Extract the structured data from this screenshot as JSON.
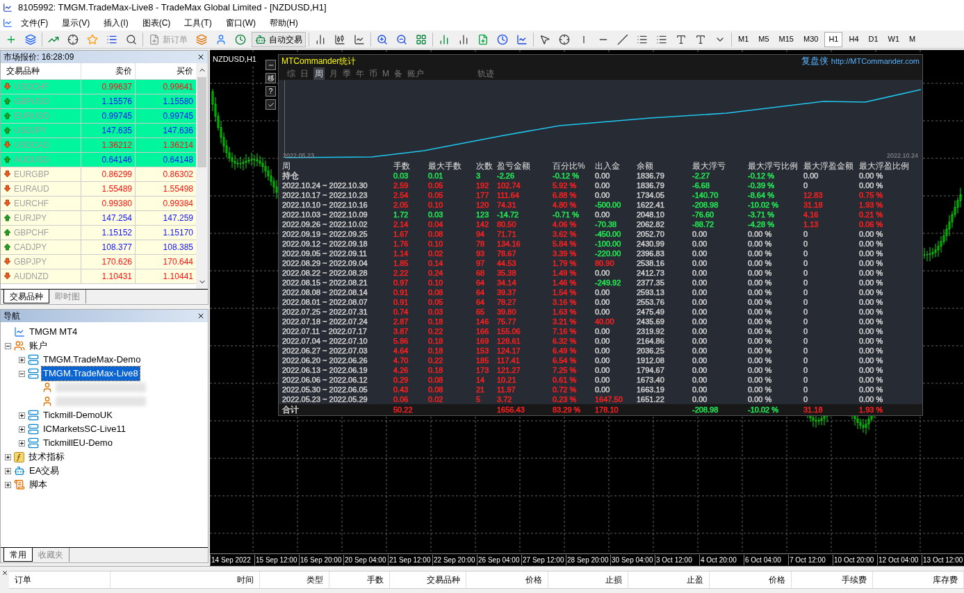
{
  "window": {
    "title": "8105992: TMGM.TradeMax-Live8 - TradeMax Global Limited - [NZDUSD,H1]"
  },
  "menu": [
    "文件(F)",
    "显示(V)",
    "插入(I)",
    "图表(C)",
    "工具(T)",
    "窗口(W)",
    "帮助(H)"
  ],
  "toolbar": {
    "new_order": {
      "label": "新订单",
      "disabled": true
    },
    "auto_trading": {
      "label": "自动交易"
    },
    "timeframes": [
      {
        "label": "M1",
        "selected": false
      },
      {
        "label": "M5",
        "selected": false
      },
      {
        "label": "M15",
        "selected": false
      },
      {
        "label": "M30",
        "selected": false
      },
      {
        "label": "H1",
        "selected": true
      },
      {
        "label": "H4",
        "selected": false
      },
      {
        "label": "D1",
        "selected": false
      },
      {
        "label": "W1",
        "selected": false
      },
      {
        "label": "M",
        "selected": false
      }
    ]
  },
  "market_watch": {
    "title": "市场报价: 16:28:09",
    "columns": [
      "交易品种",
      "卖价",
      "买价"
    ],
    "rows": [
      {
        "symbol": "USDCHF",
        "bid": "0.99637",
        "ask": "0.99641",
        "kind": "down",
        "highlighted": true
      },
      {
        "symbol": "GBPUSD",
        "bid": "1.15576",
        "ask": "1.15580",
        "kind": "up",
        "highlighted": true
      },
      {
        "symbol": "EURUSD",
        "bid": "0.99745",
        "ask": "0.99745",
        "kind": "up",
        "highlighted": true
      },
      {
        "symbol": "USDJPY",
        "bid": "147.635",
        "ask": "147.636",
        "kind": "up",
        "highlighted": true
      },
      {
        "symbol": "USDCAD",
        "bid": "1.36212",
        "ask": "1.36214",
        "kind": "down",
        "highlighted": true
      },
      {
        "symbol": "AUDUSD",
        "bid": "0.64146",
        "ask": "0.64148",
        "kind": "up",
        "highlighted": true
      },
      {
        "symbol": "EURGBP",
        "bid": "0.86299",
        "ask": "0.86302",
        "kind": "down",
        "highlighted": false
      },
      {
        "symbol": "EURAUD",
        "bid": "1.55489",
        "ask": "1.55498",
        "kind": "down",
        "highlighted": false
      },
      {
        "symbol": "EURCHF",
        "bid": "0.99380",
        "ask": "0.99384",
        "kind": "down",
        "highlighted": false
      },
      {
        "symbol": "EURJPY",
        "bid": "147.254",
        "ask": "147.259",
        "kind": "up",
        "highlighted": false
      },
      {
        "symbol": "GBPCHF",
        "bid": "1.15152",
        "ask": "1.15170",
        "kind": "up",
        "highlighted": false
      },
      {
        "symbol": "CADJPY",
        "bid": "108.377",
        "ask": "108.385",
        "kind": "up",
        "highlighted": false
      },
      {
        "symbol": "GBPJPY",
        "bid": "170.626",
        "ask": "170.644",
        "kind": "down",
        "highlighted": false
      },
      {
        "symbol": "AUDNZD",
        "bid": "1.10431",
        "ask": "1.10441",
        "kind": "down",
        "highlighted": false
      }
    ],
    "tabs": [
      {
        "label": "交易品种",
        "selected": true
      },
      {
        "label": "即时图",
        "selected": false
      }
    ]
  },
  "navigator": {
    "title": "导航",
    "tree": [
      {
        "label": "TMGM MT4",
        "kind": "terminal",
        "selected": false
      },
      {
        "label": "账户",
        "kind": "accounts",
        "expanded": true,
        "selected": false,
        "children": [
          {
            "label": "TMGM.TradeMax-Demo",
            "kind": "server",
            "expanded": false,
            "selected": false
          },
          {
            "label": "TMGM.TradeMax-Live8",
            "kind": "server",
            "expanded": true,
            "selected": true,
            "children": [
              {
                "kind": "user"
              },
              {
                "kind": "user"
              }
            ]
          },
          {
            "label": "Tickmill-DemoUK",
            "kind": "server",
            "expanded": false,
            "selected": false
          },
          {
            "label": "ICMarketsSC-Live11",
            "kind": "server",
            "expanded": false,
            "selected": false
          },
          {
            "label": "TickmillEU-Demo",
            "kind": "server",
            "expanded": false,
            "selected": false
          }
        ]
      },
      {
        "label": "技术指标",
        "kind": "indicators",
        "expanded": false,
        "selected": false
      },
      {
        "label": "EA交易",
        "kind": "experts",
        "expanded": false,
        "selected": false
      },
      {
        "label": "脚本",
        "kind": "scripts",
        "expanded": false,
        "selected": false
      }
    ],
    "tabs": [
      {
        "label": "常用",
        "selected": true
      },
      {
        "label": "收藏夹",
        "selected": false
      }
    ]
  },
  "chart": {
    "title": "NZDUSD,H1",
    "side_buttons": [
      "移",
      "?"
    ],
    "time_axis": [
      "14 Sep 2022",
      "15 Sep 12:00",
      "16 Sep 20:00",
      "20 Sep 04:00",
      "21 Sep 12:00",
      "22 Sep 20:00",
      "26 Sep 04:00",
      "27 Sep 12:00",
      "28 Sep 20:00",
      "30 Sep 04:00",
      "3 Oct 12:00",
      "4 Oct 20:00",
      "6 Oct 04:00",
      "7 Oct 12:00",
      "10 Oct 20:00",
      "12 Oct 04:00",
      "13 Oct 12:00"
    ]
  },
  "stats": {
    "title": "MTCommander统计",
    "link_label": "复盘侠",
    "link_url": "http://MTCommander.com",
    "tabs": [
      {
        "label": "综",
        "selected": false
      },
      {
        "label": "日",
        "selected": false
      },
      {
        "label": "周",
        "selected": true
      },
      {
        "label": "月",
        "selected": false
      },
      {
        "label": "季",
        "selected": false
      },
      {
        "label": "年",
        "selected": false
      },
      {
        "label": "币",
        "selected": false
      },
      {
        "label": "M",
        "selected": false
      },
      {
        "label": "备",
        "selected": false
      },
      {
        "label": "账户",
        "selected": false
      },
      {
        "label": "轨迹",
        "selected": false
      }
    ],
    "curve": {
      "start_label": "2022.05.23",
      "end_label": "2022.10.24"
    },
    "columns": [
      "周",
      "手数",
      "最大手数",
      "次数",
      "盈亏金额",
      "百分比%",
      "出入金",
      "余额",
      "最大浮亏",
      "最大浮亏比例",
      "最大浮盈金额",
      "最大浮盈比例"
    ],
    "rows": [
      {
        "cells": [
          {
            "text": "持仓"
          },
          {
            "text": "0.03",
            "color": "#22ee55"
          },
          {
            "text": "0.01",
            "color": "#22ee55"
          },
          {
            "text": "3",
            "color": "#22ee55"
          },
          {
            "text": "-2.26",
            "color": "#22ee55"
          },
          {
            "text": "-0.12 %",
            "color": "#22ee55"
          },
          {
            "text": "0.00"
          },
          {
            "text": "1836.79"
          },
          {
            "text": "-2.27",
            "color": "#22ee55"
          },
          {
            "text": "-0.12 %",
            "color": "#22ee55"
          },
          {
            "text": "0.00"
          },
          {
            "text": "0.00 %"
          }
        ]
      },
      {
        "cells": [
          {
            "text": "2022.10.24 ~ 2022.10.30"
          },
          {
            "text": "2.59",
            "color": "#ff2020"
          },
          {
            "text": "0.05",
            "color": "#ff2020"
          },
          {
            "text": "192",
            "color": "#ff2020"
          },
          {
            "text": "102.74",
            "color": "#ff2020"
          },
          {
            "text": "5.92 %",
            "color": "#ff2020"
          },
          {
            "text": "0.00"
          },
          {
            "text": "1836.79"
          },
          {
            "text": "-6.68",
            "color": "#22ee55"
          },
          {
            "text": "-0.39 %",
            "color": "#22ee55"
          },
          {
            "text": "0"
          },
          {
            "text": "0.00 %"
          }
        ]
      },
      {
        "cells": [
          {
            "text": "2022.10.17 ~ 2022.10.23"
          },
          {
            "text": "2.54",
            "color": "#ff2020"
          },
          {
            "text": "0.05",
            "color": "#ff2020"
          },
          {
            "text": "177",
            "color": "#ff2020"
          },
          {
            "text": "111.64",
            "color": "#ff2020"
          },
          {
            "text": "6.88 %",
            "color": "#ff2020"
          },
          {
            "text": "0.00"
          },
          {
            "text": "1734.05"
          },
          {
            "text": "-140.70",
            "color": "#22ee55"
          },
          {
            "text": "-8.64 %",
            "color": "#22ee55"
          },
          {
            "text": "12.83",
            "color": "#ff2020"
          },
          {
            "text": "0.75 %",
            "color": "#ff2020"
          }
        ]
      },
      {
        "cells": [
          {
            "text": "2022.10.10 ~ 2022.10.16"
          },
          {
            "text": "2.05",
            "color": "#ff2020"
          },
          {
            "text": "0.10",
            "color": "#ff2020"
          },
          {
            "text": "120",
            "color": "#ff2020"
          },
          {
            "text": "74.31",
            "color": "#ff2020"
          },
          {
            "text": "4.80 %",
            "color": "#ff2020"
          },
          {
            "text": "-500.00",
            "color": "#22ee55"
          },
          {
            "text": "1622.41"
          },
          {
            "text": "-208.98",
            "color": "#22ee55"
          },
          {
            "text": "-10.02 %",
            "color": "#22ee55"
          },
          {
            "text": "31.18",
            "color": "#ff2020"
          },
          {
            "text": "1.93 %",
            "color": "#ff2020"
          }
        ]
      },
      {
        "cells": [
          {
            "text": "2022.10.03 ~ 2022.10.09"
          },
          {
            "text": "1.72",
            "color": "#22ee55"
          },
          {
            "text": "0.03",
            "color": "#22ee55"
          },
          {
            "text": "123",
            "color": "#22ee55"
          },
          {
            "text": "-14.72",
            "color": "#22ee55"
          },
          {
            "text": "-0.71 %",
            "color": "#22ee55"
          },
          {
            "text": "0.00"
          },
          {
            "text": "2048.10"
          },
          {
            "text": "-76.60",
            "color": "#22ee55"
          },
          {
            "text": "-3.71 %",
            "color": "#22ee55"
          },
          {
            "text": "4.16",
            "color": "#ff2020"
          },
          {
            "text": "0.21 %",
            "color": "#ff2020"
          }
        ]
      },
      {
        "cells": [
          {
            "text": "2022.09.26 ~ 2022.10.02"
          },
          {
            "text": "2.14",
            "color": "#ff2020"
          },
          {
            "text": "0.04",
            "color": "#ff2020"
          },
          {
            "text": "142",
            "color": "#ff2020"
          },
          {
            "text": "80.50",
            "color": "#ff2020"
          },
          {
            "text": "4.06 %",
            "color": "#ff2020"
          },
          {
            "text": "-70.38",
            "color": "#22ee55"
          },
          {
            "text": "2062.82"
          },
          {
            "text": "-88.72",
            "color": "#22ee55"
          },
          {
            "text": "-4.28 %",
            "color": "#22ee55"
          },
          {
            "text": "1.13",
            "color": "#ff2020"
          },
          {
            "text": "0.06 %",
            "color": "#ff2020"
          }
        ]
      },
      {
        "cells": [
          {
            "text": "2022.09.19 ~ 2022.09.25"
          },
          {
            "text": "1.67",
            "color": "#ff2020"
          },
          {
            "text": "0.08",
            "color": "#ff2020"
          },
          {
            "text": "94",
            "color": "#ff2020"
          },
          {
            "text": "71.71",
            "color": "#ff2020"
          },
          {
            "text": "3.62 %",
            "color": "#ff2020"
          },
          {
            "text": "-450.00",
            "color": "#22ee55"
          },
          {
            "text": "2052.70"
          },
          {
            "text": "0.00"
          },
          {
            "text": "0.00 %"
          },
          {
            "text": "0"
          },
          {
            "text": "0.00 %"
          }
        ]
      },
      {
        "cells": [
          {
            "text": "2022.09.12 ~ 2022.09.18"
          },
          {
            "text": "1.76",
            "color": "#ff2020"
          },
          {
            "text": "0.10",
            "color": "#ff2020"
          },
          {
            "text": "78",
            "color": "#ff2020"
          },
          {
            "text": "134.16",
            "color": "#ff2020"
          },
          {
            "text": "5.84 %",
            "color": "#ff2020"
          },
          {
            "text": "-100.00",
            "color": "#22ee55"
          },
          {
            "text": "2430.99"
          },
          {
            "text": "0.00"
          },
          {
            "text": "0.00 %"
          },
          {
            "text": "0"
          },
          {
            "text": "0.00 %"
          }
        ]
      },
      {
        "cells": [
          {
            "text": "2022.09.05 ~ 2022.09.11"
          },
          {
            "text": "1.14",
            "color": "#ff2020"
          },
          {
            "text": "0.02",
            "color": "#ff2020"
          },
          {
            "text": "93",
            "color": "#ff2020"
          },
          {
            "text": "78.67",
            "color": "#ff2020"
          },
          {
            "text": "3.39 %",
            "color": "#ff2020"
          },
          {
            "text": "-220.00",
            "color": "#22ee55"
          },
          {
            "text": "2396.83"
          },
          {
            "text": "0.00"
          },
          {
            "text": "0.00 %"
          },
          {
            "text": "0"
          },
          {
            "text": "0.00 %"
          }
        ]
      },
      {
        "cells": [
          {
            "text": "2022.08.29 ~ 2022.09.04"
          },
          {
            "text": "1.85",
            "color": "#ff2020"
          },
          {
            "text": "0.14",
            "color": "#ff2020"
          },
          {
            "text": "97",
            "color": "#ff2020"
          },
          {
            "text": "44.53",
            "color": "#ff2020"
          },
          {
            "text": "1.79 %",
            "color": "#ff2020"
          },
          {
            "text": "80.90",
            "color": "#ff2020"
          },
          {
            "text": "2538.16"
          },
          {
            "text": "0.00"
          },
          {
            "text": "0.00 %"
          },
          {
            "text": "0"
          },
          {
            "text": "0.00 %"
          }
        ]
      },
      {
        "cells": [
          {
            "text": "2022.08.22 ~ 2022.08.28"
          },
          {
            "text": "2.22",
            "color": "#ff2020"
          },
          {
            "text": "0.24",
            "color": "#ff2020"
          },
          {
            "text": "68",
            "color": "#ff2020"
          },
          {
            "text": "35.38",
            "color": "#ff2020"
          },
          {
            "text": "1.49 %",
            "color": "#ff2020"
          },
          {
            "text": "0.00"
          },
          {
            "text": "2412.73"
          },
          {
            "text": "0.00"
          },
          {
            "text": "0.00 %"
          },
          {
            "text": "0"
          },
          {
            "text": "0.00 %"
          }
        ]
      },
      {
        "cells": [
          {
            "text": "2022.08.15 ~ 2022.08.21"
          },
          {
            "text": "0.97",
            "color": "#ff2020"
          },
          {
            "text": "0.10",
            "color": "#ff2020"
          },
          {
            "text": "64",
            "color": "#ff2020"
          },
          {
            "text": "34.14",
            "color": "#ff2020"
          },
          {
            "text": "1.46 %",
            "color": "#ff2020"
          },
          {
            "text": "-249.92",
            "color": "#22ee55"
          },
          {
            "text": "2377.35"
          },
          {
            "text": "0.00"
          },
          {
            "text": "0.00 %"
          },
          {
            "text": "0"
          },
          {
            "text": "0.00 %"
          }
        ]
      },
      {
        "cells": [
          {
            "text": "2022.08.08 ~ 2022.08.14"
          },
          {
            "text": "0.91",
            "color": "#ff2020"
          },
          {
            "text": "0.08",
            "color": "#ff2020"
          },
          {
            "text": "64",
            "color": "#ff2020"
          },
          {
            "text": "39.37",
            "color": "#ff2020"
          },
          {
            "text": "1.54 %",
            "color": "#ff2020"
          },
          {
            "text": "0.00"
          },
          {
            "text": "2593.13"
          },
          {
            "text": "0.00"
          },
          {
            "text": "0.00 %"
          },
          {
            "text": "0"
          },
          {
            "text": "0.00 %"
          }
        ]
      },
      {
        "cells": [
          {
            "text": "2022.08.01 ~ 2022.08.07"
          },
          {
            "text": "0.91",
            "color": "#ff2020"
          },
          {
            "text": "0.05",
            "color": "#ff2020"
          },
          {
            "text": "64",
            "color": "#ff2020"
          },
          {
            "text": "78.27",
            "color": "#ff2020"
          },
          {
            "text": "3.16 %",
            "color": "#ff2020"
          },
          {
            "text": "0.00"
          },
          {
            "text": "2553.76"
          },
          {
            "text": "0.00"
          },
          {
            "text": "0.00 %"
          },
          {
            "text": "0"
          },
          {
            "text": "0.00 %"
          }
        ]
      },
      {
        "cells": [
          {
            "text": "2022.07.25 ~ 2022.07.31"
          },
          {
            "text": "0.74",
            "color": "#ff2020"
          },
          {
            "text": "0.03",
            "color": "#ff2020"
          },
          {
            "text": "65",
            "color": "#ff2020"
          },
          {
            "text": "39.80",
            "color": "#ff2020"
          },
          {
            "text": "1.63 %",
            "color": "#ff2020"
          },
          {
            "text": "0.00"
          },
          {
            "text": "2475.49"
          },
          {
            "text": "0.00"
          },
          {
            "text": "0.00 %"
          },
          {
            "text": "0"
          },
          {
            "text": "0.00 %"
          }
        ]
      },
      {
        "cells": [
          {
            "text": "2022.07.18 ~ 2022.07.24"
          },
          {
            "text": "2.87",
            "color": "#ff2020"
          },
          {
            "text": "0.18",
            "color": "#ff2020"
          },
          {
            "text": "146",
            "color": "#ff2020"
          },
          {
            "text": "75.77",
            "color": "#ff2020"
          },
          {
            "text": "3.21 %",
            "color": "#ff2020"
          },
          {
            "text": "40.00",
            "color": "#ff2020"
          },
          {
            "text": "2435.69"
          },
          {
            "text": "0.00"
          },
          {
            "text": "0.00 %"
          },
          {
            "text": "0"
          },
          {
            "text": "0.00 %"
          }
        ]
      },
      {
        "cells": [
          {
            "text": "2022.07.11 ~ 2022.07.17"
          },
          {
            "text": "3.87",
            "color": "#ff2020"
          },
          {
            "text": "0.22",
            "color": "#ff2020"
          },
          {
            "text": "166",
            "color": "#ff2020"
          },
          {
            "text": "155.06",
            "color": "#ff2020"
          },
          {
            "text": "7.16 %",
            "color": "#ff2020"
          },
          {
            "text": "0.00"
          },
          {
            "text": "2319.92"
          },
          {
            "text": "0.00"
          },
          {
            "text": "0.00 %"
          },
          {
            "text": "0"
          },
          {
            "text": "0.00 %"
          }
        ]
      },
      {
        "cells": [
          {
            "text": "2022.07.04 ~ 2022.07.10"
          },
          {
            "text": "5.86",
            "color": "#ff2020"
          },
          {
            "text": "0.18",
            "color": "#ff2020"
          },
          {
            "text": "169",
            "color": "#ff2020"
          },
          {
            "text": "128.61",
            "color": "#ff2020"
          },
          {
            "text": "6.32 %",
            "color": "#ff2020"
          },
          {
            "text": "0.00"
          },
          {
            "text": "2164.86"
          },
          {
            "text": "0.00"
          },
          {
            "text": "0.00 %"
          },
          {
            "text": "0"
          },
          {
            "text": "0.00 %"
          }
        ]
      },
      {
        "cells": [
          {
            "text": "2022.06.27 ~ 2022.07.03"
          },
          {
            "text": "4.64",
            "color": "#ff2020"
          },
          {
            "text": "0.18",
            "color": "#ff2020"
          },
          {
            "text": "153",
            "color": "#ff2020"
          },
          {
            "text": "124.17",
            "color": "#ff2020"
          },
          {
            "text": "6.49 %",
            "color": "#ff2020"
          },
          {
            "text": "0.00"
          },
          {
            "text": "2036.25"
          },
          {
            "text": "0.00"
          },
          {
            "text": "0.00 %"
          },
          {
            "text": "0"
          },
          {
            "text": "0.00 %"
          }
        ]
      },
      {
        "cells": [
          {
            "text": "2022.06.20 ~ 2022.06.26"
          },
          {
            "text": "4.70",
            "color": "#ff2020"
          },
          {
            "text": "0.22",
            "color": "#ff2020"
          },
          {
            "text": "185",
            "color": "#ff2020"
          },
          {
            "text": "117.41",
            "color": "#ff2020"
          },
          {
            "text": "6.54 %",
            "color": "#ff2020"
          },
          {
            "text": "0.00"
          },
          {
            "text": "1912.08"
          },
          {
            "text": "0.00"
          },
          {
            "text": "0.00 %"
          },
          {
            "text": "0"
          },
          {
            "text": "0.00 %"
          }
        ]
      },
      {
        "cells": [
          {
            "text": "2022.06.13 ~ 2022.06.19"
          },
          {
            "text": "4.26",
            "color": "#ff2020"
          },
          {
            "text": "0.18",
            "color": "#ff2020"
          },
          {
            "text": "173",
            "color": "#ff2020"
          },
          {
            "text": "121.27",
            "color": "#ff2020"
          },
          {
            "text": "7.25 %",
            "color": "#ff2020"
          },
          {
            "text": "0.00"
          },
          {
            "text": "1794.67"
          },
          {
            "text": "0.00"
          },
          {
            "text": "0.00 %"
          },
          {
            "text": "0"
          },
          {
            "text": "0.00 %"
          }
        ]
      },
      {
        "cells": [
          {
            "text": "2022.06.06 ~ 2022.06.12"
          },
          {
            "text": "0.29",
            "color": "#ff2020"
          },
          {
            "text": "0.08",
            "color": "#ff2020"
          },
          {
            "text": "14",
            "color": "#ff2020"
          },
          {
            "text": "10.21",
            "color": "#ff2020"
          },
          {
            "text": "0.61 %",
            "color": "#ff2020"
          },
          {
            "text": "0.00"
          },
          {
            "text": "1673.40"
          },
          {
            "text": "0.00"
          },
          {
            "text": "0.00 %"
          },
          {
            "text": "0"
          },
          {
            "text": "0.00 %"
          }
        ]
      },
      {
        "cells": [
          {
            "text": "2022.05.30 ~ 2022.06.05"
          },
          {
            "text": "0.43",
            "color": "#ff2020"
          },
          {
            "text": "0.08",
            "color": "#ff2020"
          },
          {
            "text": "21",
            "color": "#ff2020"
          },
          {
            "text": "11.97",
            "color": "#ff2020"
          },
          {
            "text": "0.72 %",
            "color": "#ff2020"
          },
          {
            "text": "0.00"
          },
          {
            "text": "1663.19"
          },
          {
            "text": "0.00"
          },
          {
            "text": "0.00 %"
          },
          {
            "text": "0"
          },
          {
            "text": "0.00 %"
          }
        ]
      },
      {
        "cells": [
          {
            "text": "2022.05.23 ~ 2022.05.29"
          },
          {
            "text": "0.06",
            "color": "#ff2020"
          },
          {
            "text": "0.02",
            "color": "#ff2020"
          },
          {
            "text": "5",
            "color": "#ff2020"
          },
          {
            "text": "3.72",
            "color": "#ff2020"
          },
          {
            "text": "0.23 %",
            "color": "#ff2020"
          },
          {
            "text": "1647.50",
            "color": "#ff2020"
          },
          {
            "text": "1651.22"
          },
          {
            "text": "0.00"
          },
          {
            "text": "0.00 %"
          },
          {
            "text": "0"
          },
          {
            "text": "0.00 %"
          }
        ]
      }
    ],
    "total": {
      "label": {
        "text": "合计"
      },
      "lots": {
        "text": "50.22",
        "color": "#ff2020"
      },
      "profit": {
        "text": "1656.43",
        "color": "#ff2020"
      },
      "percent": {
        "text": "83.29 %",
        "color": "#ff2020"
      },
      "deposit": {
        "text": "178.10",
        "color": "#ff2020"
      },
      "max_loss": {
        "text": "-208.98",
        "color": "#22ee55"
      },
      "max_loss_pct": {
        "text": "-10.02 %",
        "color": "#22ee55"
      },
      "max_gain": {
        "text": "31.18",
        "color": "#ff2020"
      },
      "max_gain_pct": {
        "text": "1.93 %",
        "color": "#ff2020"
      }
    }
  },
  "terminal": {
    "columns": [
      "订单",
      "时间",
      "类型",
      "手数",
      "交易品种",
      "价格",
      "止损",
      "止盈",
      "价格",
      "手续费",
      "库存费"
    ]
  }
}
